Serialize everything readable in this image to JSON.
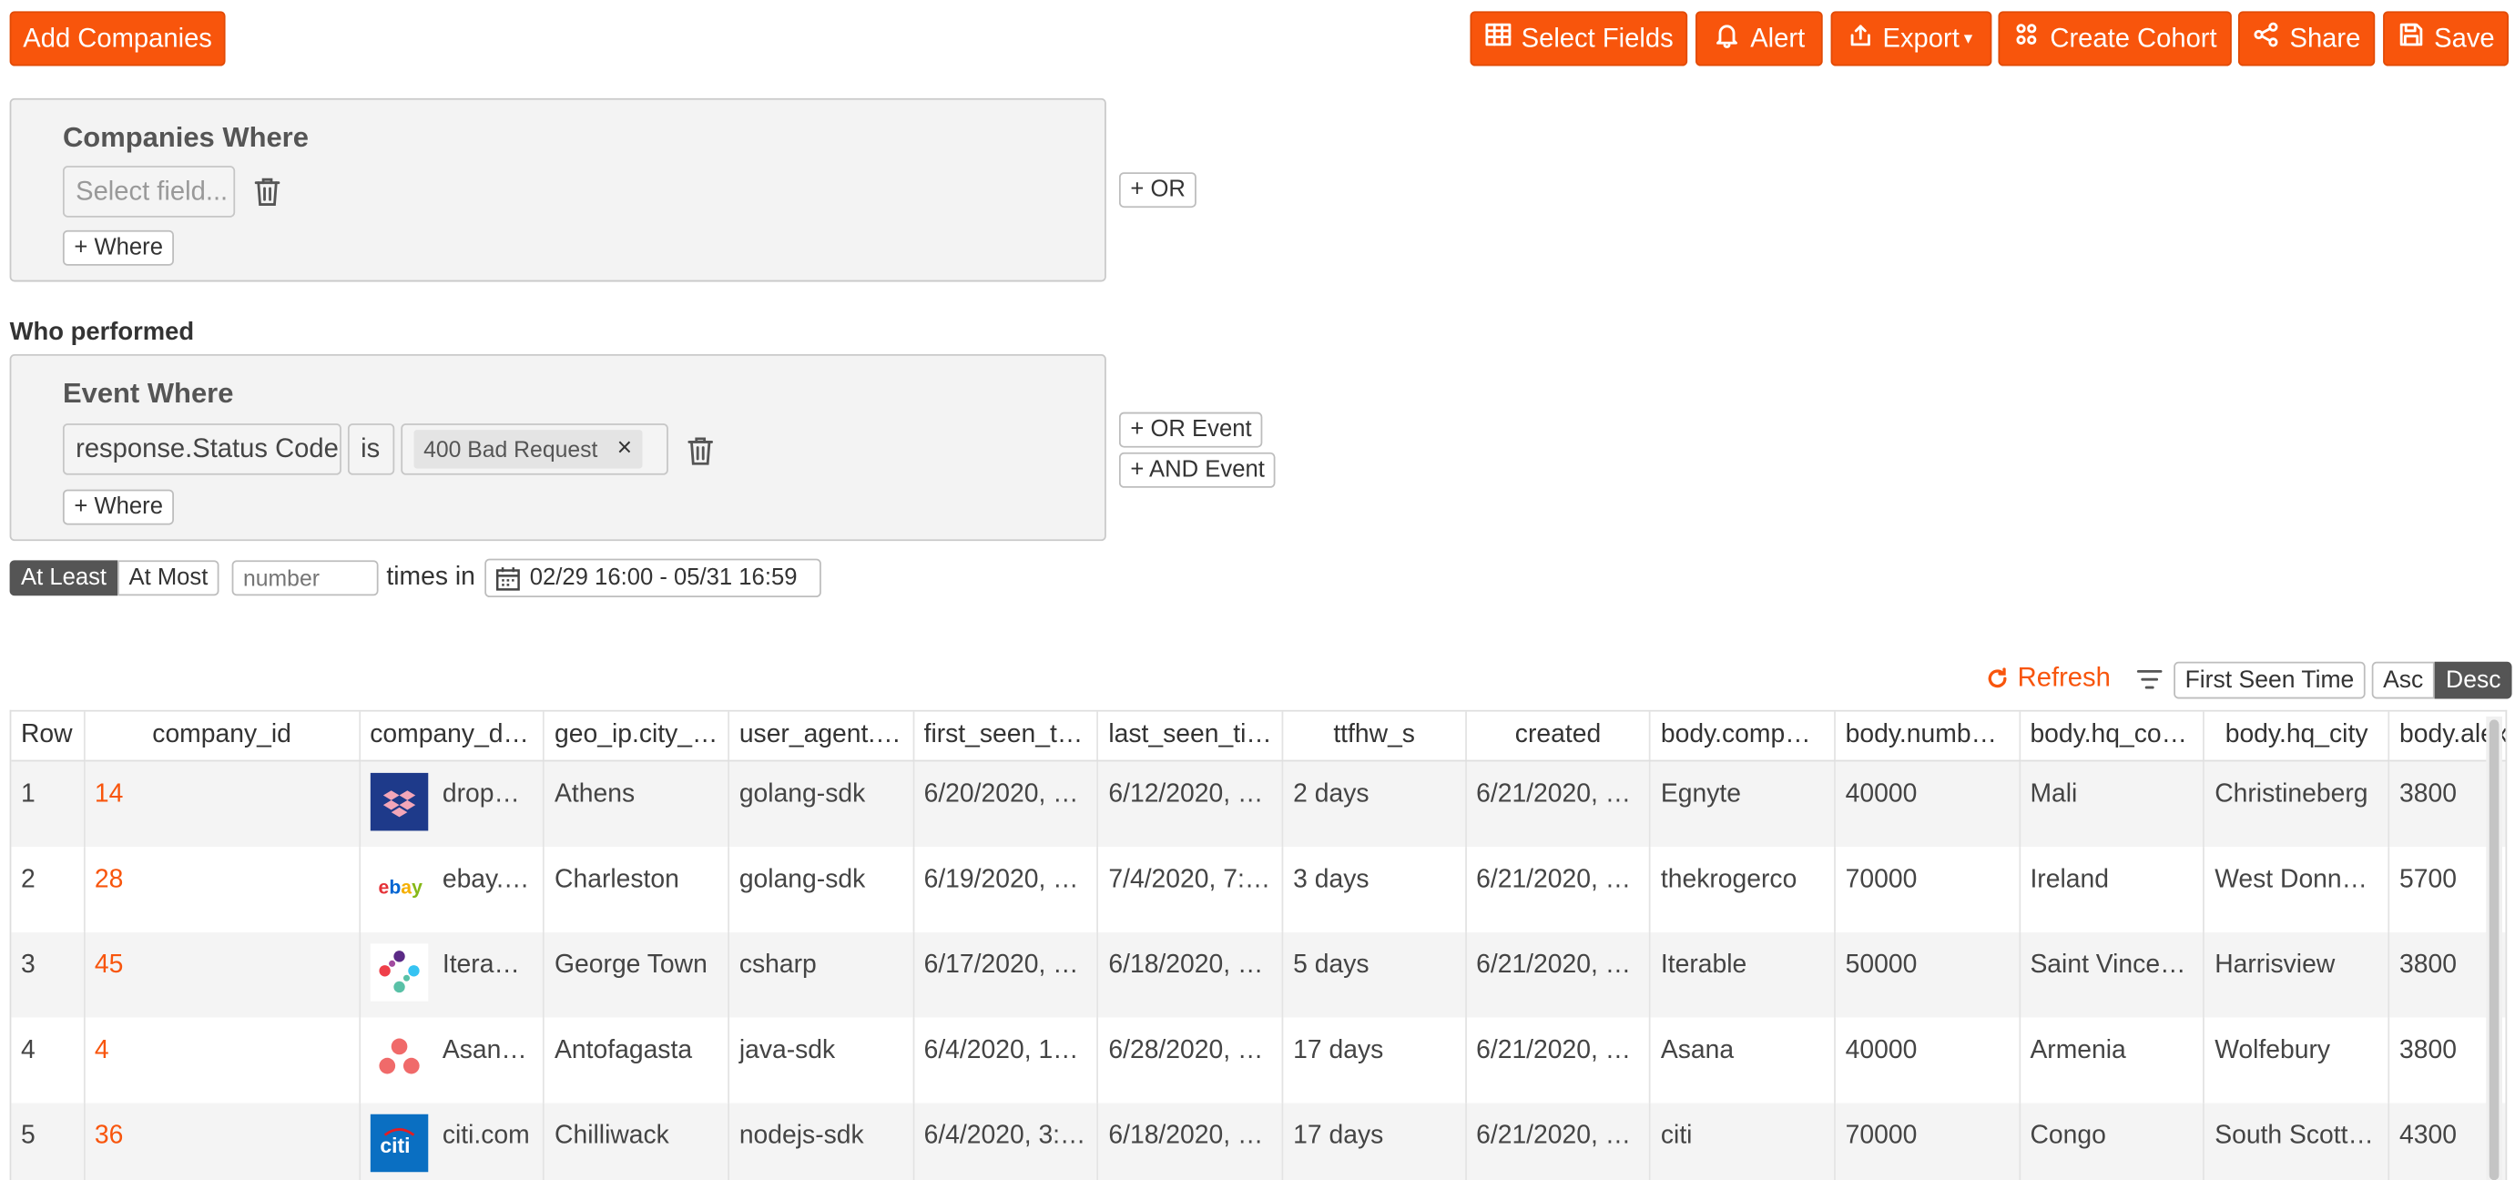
{
  "toolbar": {
    "add_companies": "Add Companies",
    "select_fields": "Select Fields",
    "alert": "Alert",
    "export": "Export",
    "create_cohort": "Create Cohort",
    "share": "Share",
    "save": "Save"
  },
  "companies_filter": {
    "title": "Companies Where",
    "field_placeholder": "Select field...",
    "add_where": "+ Where",
    "or_button": "+ OR"
  },
  "who_performed": "Who performed",
  "event_filter": {
    "title": "Event Where",
    "field": "response.Status Code",
    "operator": "is",
    "value_tag": "400 Bad Request",
    "remove_tag": "×",
    "add_where": "+ Where",
    "or_event": "+ OR Event",
    "and_event": "+ AND Event"
  },
  "frequency": {
    "at_least": "At Least",
    "at_most": "At Most",
    "number_placeholder": "number",
    "times_in": "times in",
    "date_range": "02/29 16:00 - 05/31 16:59"
  },
  "sort_bar": {
    "refresh": "Refresh",
    "sort_field": "First Seen Time",
    "asc": "Asc",
    "desc": "Desc",
    "active_order": "Desc"
  },
  "colors": {
    "accent": "#f8550c",
    "active_segment": "#555555"
  },
  "table": {
    "headers": [
      "Row",
      "company_id",
      "company_d…",
      "geo_ip.city_…",
      "user_agent.…",
      "first_seen_ti…",
      "last_seen_ti…",
      "ttfhw_s",
      "created",
      "body.compa…",
      "body.numbe…",
      "body.hq_cou…",
      "body.hq_city",
      "body.alex"
    ],
    "rows": [
      {
        "row": "1",
        "company_id": "14",
        "logo": "dropbox-logo",
        "domain": "dropbox.",
        "city": "Athens",
        "agent": "golang-sdk",
        "first_seen": "6/20/2020, …",
        "last_seen": "6/12/2020, …",
        "ttfhw": "2 days",
        "created": "6/21/2020, …",
        "company": "Egnyte",
        "number": "40000",
        "country": "Mali",
        "hq_city": "Christineberg",
        "alexa": "3800"
      },
      {
        "row": "2",
        "company_id": "28",
        "logo": "ebay-logo",
        "domain": "ebay.com",
        "city": "Charleston",
        "agent": "golang-sdk",
        "first_seen": "6/19/2020, …",
        "last_seen": "7/4/2020, 7:…",
        "ttfhw": "3 days",
        "created": "6/21/2020, …",
        "company": "thekrogerco",
        "number": "70000",
        "country": "Ireland",
        "hq_city": "West Donna…",
        "alexa": "5700"
      },
      {
        "row": "3",
        "company_id": "45",
        "logo": "iterable-logo",
        "domain": "Iterable.c",
        "city": "George Town",
        "agent": "csharp",
        "first_seen": "6/17/2020, …",
        "last_seen": "6/18/2020, …",
        "ttfhw": "5 days",
        "created": "6/21/2020, …",
        "company": "Iterable",
        "number": "50000",
        "country": "Saint Vincen…",
        "hq_city": "Harrisview",
        "alexa": "3800"
      },
      {
        "row": "4",
        "company_id": "4",
        "logo": "asana-logo",
        "domain": "Asana.co",
        "city": "Antofagasta",
        "agent": "java-sdk",
        "first_seen": "6/4/2020, 1…",
        "last_seen": "6/28/2020, …",
        "ttfhw": "17 days",
        "created": "6/21/2020, …",
        "company": "Asana",
        "number": "40000",
        "country": "Armenia",
        "hq_city": "Wolfebury",
        "alexa": "3800"
      },
      {
        "row": "5",
        "company_id": "36",
        "logo": "citi-logo",
        "domain": "citi.com",
        "city": "Chilliwack",
        "agent": "nodejs-sdk",
        "first_seen": "6/4/2020, 3:…",
        "last_seen": "6/18/2020, …",
        "ttfhw": "17 days",
        "created": "6/21/2020, …",
        "company": "citi",
        "number": "70000",
        "country": "Congo",
        "hq_city": "South Scott…",
        "alexa": "4300"
      }
    ]
  }
}
